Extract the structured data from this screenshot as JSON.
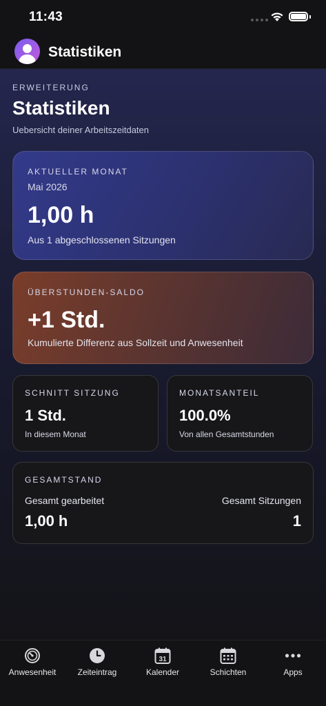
{
  "status_bar": {
    "time": "11:43"
  },
  "header": {
    "title": "Statistiken"
  },
  "page": {
    "eyebrow": "ERWEITERUNG",
    "title": "Statistiken",
    "subtitle": "Uebersicht deiner Arbeitszeitdaten"
  },
  "cards": {
    "month": {
      "label": "AKTUELLER MONAT",
      "period": "Mai 2026",
      "value": "1,00 h",
      "note": "Aus 1 abgeschlossenen Sitzungen"
    },
    "balance": {
      "label": "ÜBERSTUNDEN-SALDO",
      "value": "+1 Std.",
      "note": "Kumulierte Differenz aus Sollzeit und Anwesenheit"
    },
    "average": {
      "label": "SCHNITT SITZUNG",
      "value": "1 Std.",
      "note": "In diesem Monat"
    },
    "share": {
      "label": "MONATSANTEIL",
      "value": "100.0%",
      "note": "Von allen Gesamtstunden"
    },
    "total": {
      "label": "GESAMTSTAND",
      "worked_label": "Gesamt gearbeitet",
      "worked_value": "1,00 h",
      "sessions_label": "Gesamt Sitzungen",
      "sessions_value": "1"
    }
  },
  "tabs": [
    {
      "label": "Anwesenheit",
      "icon": "timer-icon"
    },
    {
      "label": "Zeiteintrag",
      "icon": "clock-icon"
    },
    {
      "label": "Kalender",
      "icon": "calendar-icon",
      "day": "31"
    },
    {
      "label": "Schichten",
      "icon": "schedule-grid-icon"
    },
    {
      "label": "Apps",
      "icon": "more-dots-icon"
    }
  ],
  "colors": {
    "background": "#141416",
    "month_card": "#2f3580",
    "balance_card": "#6a3a2e",
    "small_card": "#17171a"
  }
}
